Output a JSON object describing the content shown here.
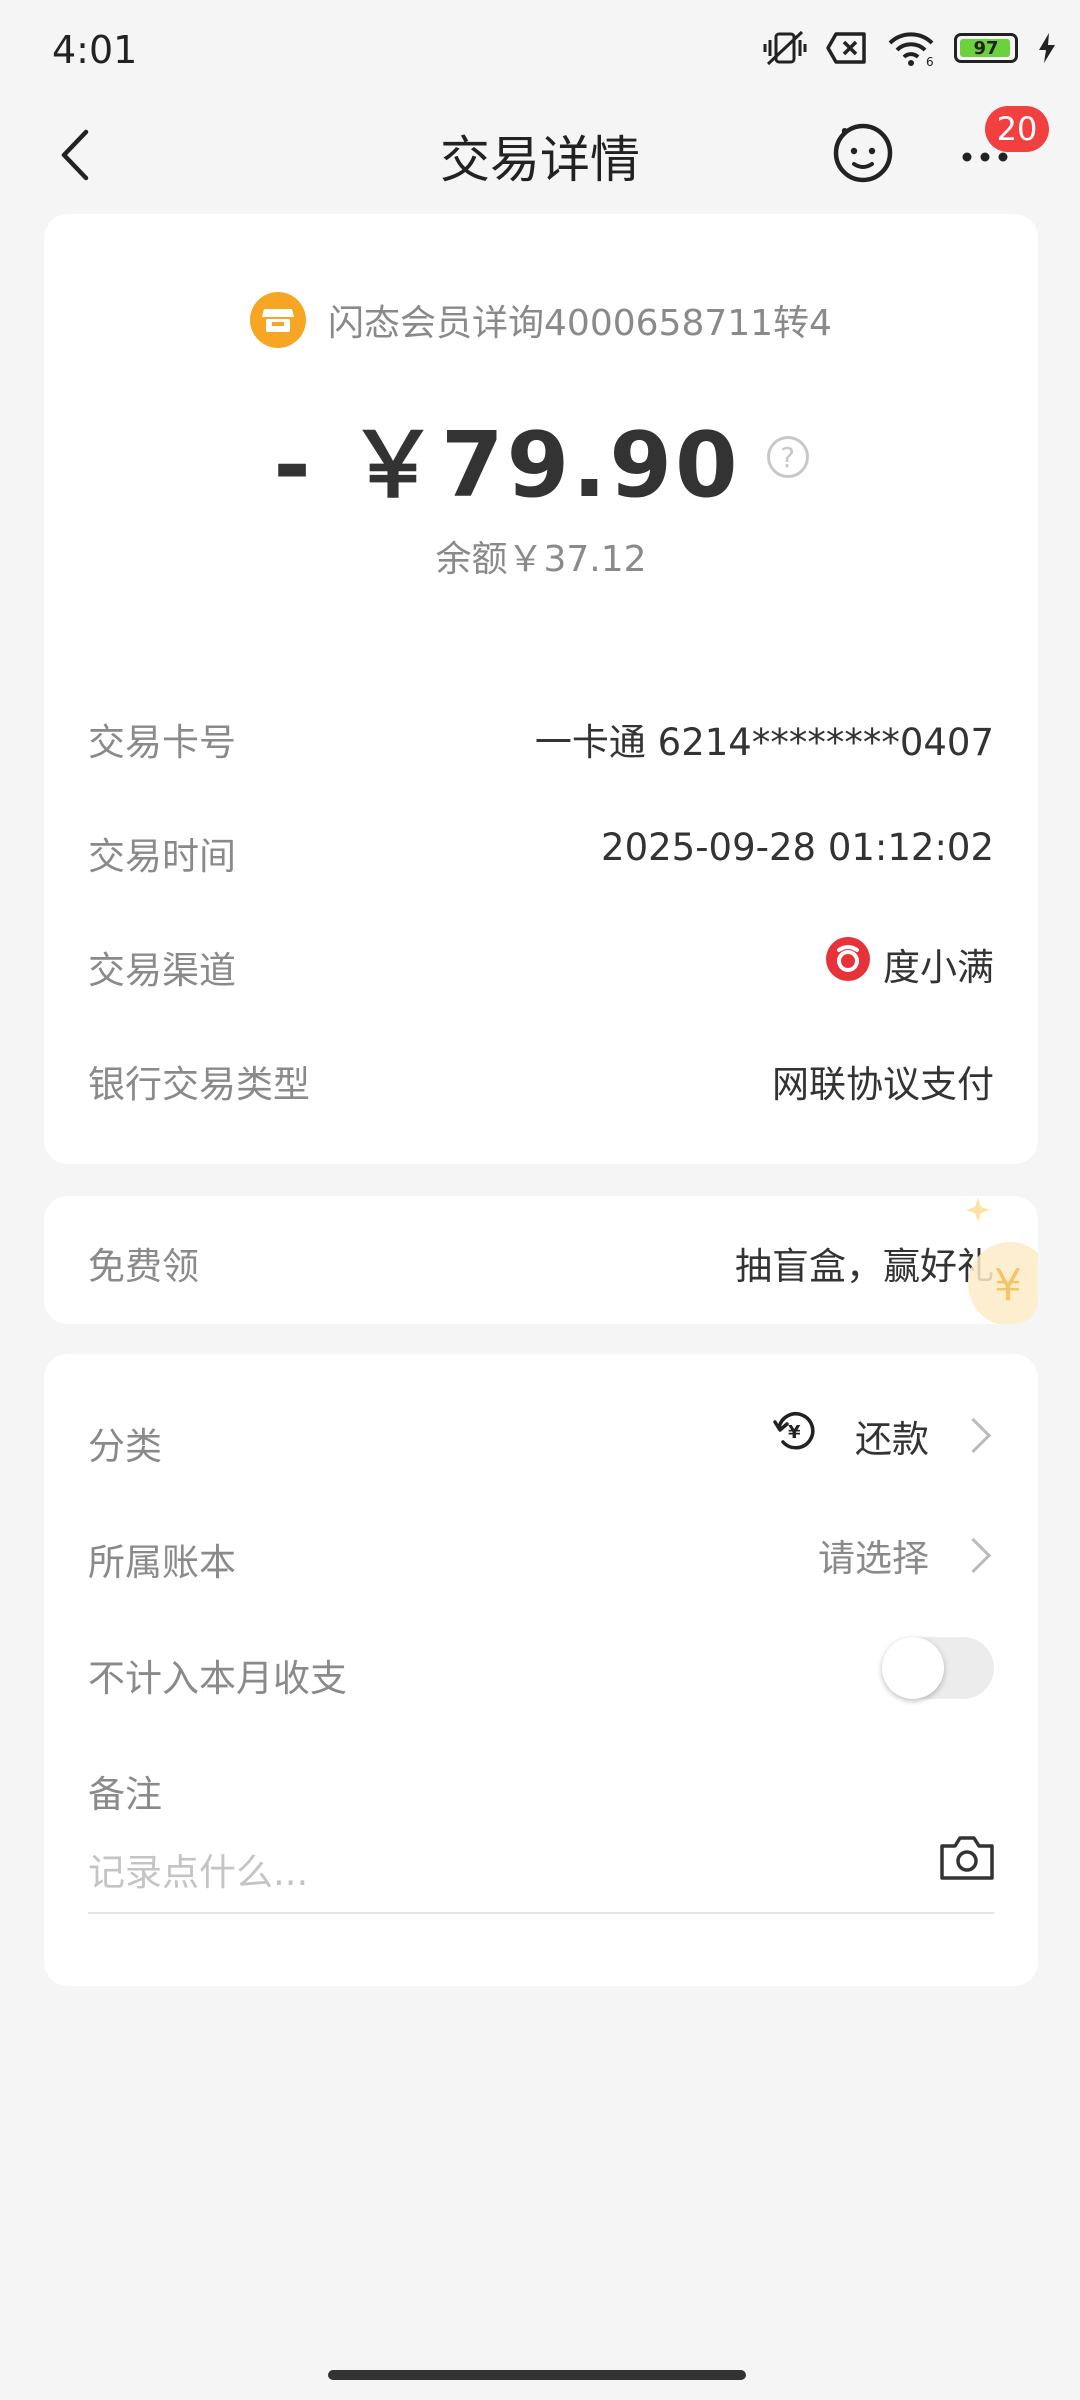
{
  "status": {
    "time": "4:01",
    "battery": "97",
    "icons": [
      "mute-vibrate-icon",
      "no-sim-icon",
      "wifi-icon",
      "battery-icon",
      "charging-icon"
    ]
  },
  "header": {
    "title": "交易详情",
    "back_icon": "chevron-left-icon",
    "service_icon": "smiley-service-icon",
    "more_icon": "more-dots-icon",
    "more_badge": "20"
  },
  "transaction": {
    "merchant": "闪态会员详询4000658711转4",
    "amount": "- ￥79.90",
    "balance": "余额￥37.12",
    "details": [
      {
        "label": "交易卡号",
        "value": "一卡通 6214********0407"
      },
      {
        "label": "交易时间",
        "value": "2025-09-28 01:12:02"
      },
      {
        "label": "交易渠道",
        "value": "度小满"
      },
      {
        "label": "银行交易类型",
        "value": "网联协议支付"
      }
    ]
  },
  "promo": {
    "label": "免费领",
    "value": "抽盲盒，赢好礼"
  },
  "classification": {
    "category_label": "分类",
    "category_value": "还款",
    "ledger_label": "所属账本",
    "ledger_value": "请选择",
    "exclude_label": "不计入本月收支",
    "exclude_on": false,
    "note_label": "备注",
    "note_placeholder": "记录点什么..."
  },
  "colors": {
    "accent_orange": "#f6a623",
    "badge_red": "#f23f3f",
    "channel_red": "#e8323a"
  }
}
